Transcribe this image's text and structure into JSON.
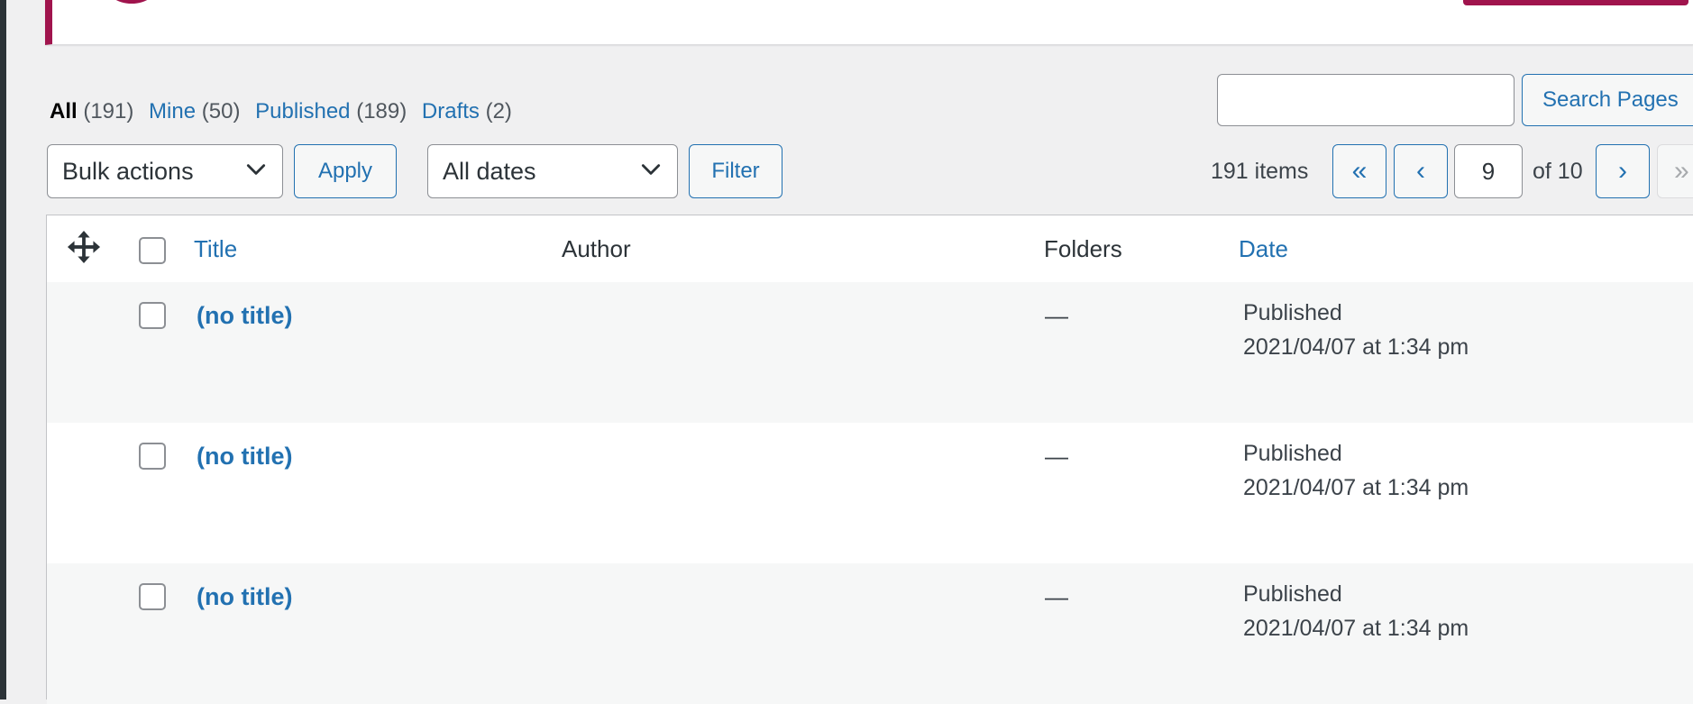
{
  "filters": {
    "all": {
      "label": "All",
      "count": "(191)"
    },
    "mine": {
      "label": "Mine",
      "count": "(50)"
    },
    "published": {
      "label": "Published",
      "count": "(189)"
    },
    "drafts": {
      "label": "Drafts",
      "count": "(2)"
    }
  },
  "search": {
    "button_label": "Search Pages",
    "value": ""
  },
  "toolbar": {
    "bulk_select": "Bulk actions",
    "apply_label": "Apply",
    "dates_select": "All dates",
    "filter_label": "Filter"
  },
  "pagination": {
    "items_count": "191 items",
    "first": "«",
    "prev": "‹",
    "current_page": "9",
    "of_label": "of 10",
    "next": "›",
    "last": "»"
  },
  "table": {
    "columns": {
      "title": "Title",
      "author": "Author",
      "folders": "Folders",
      "date": "Date"
    },
    "rows": [
      {
        "title": "(no title)",
        "author": "",
        "folders": "—",
        "status": "Published",
        "date": "2021/04/07 at 1:34 pm"
      },
      {
        "title": "(no title)",
        "author": "",
        "folders": "—",
        "status": "Published",
        "date": "2021/04/07 at 1:34 pm"
      },
      {
        "title": "(no title)",
        "author": "",
        "folders": "—",
        "status": "Published",
        "date": "2021/04/07 at 1:34 pm"
      }
    ]
  },
  "colors": {
    "link": "#2271b1",
    "accent": "#a0144d",
    "text": "#3c434a"
  },
  "icons": {
    "move": "move-arrows-icon",
    "dropdown": "chevron-down-icon"
  }
}
